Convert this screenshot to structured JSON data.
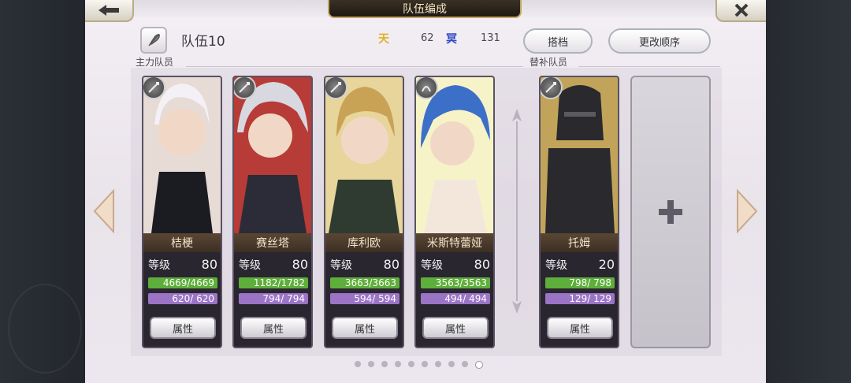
{
  "header": {
    "title": "队伍编成"
  },
  "team": {
    "name": "队伍10",
    "resource1_icon": "天",
    "resource1_value": "62",
    "resource2_icon": "冥",
    "resource2_value": "131"
  },
  "buttons": {
    "partner": "搭档",
    "change_order": "更改顺序",
    "attribute": "属性"
  },
  "sections": {
    "main": "主力队员",
    "sub": "替补队员"
  },
  "level_label": "等级",
  "members": [
    {
      "name": "桔梗",
      "level": "80",
      "hp": "4669/4669",
      "mp": "620/ 620",
      "palette": [
        "#f4f1f6",
        "#1b1b22",
        "#e7dbd6"
      ]
    },
    {
      "name": "赛丝塔",
      "level": "80",
      "hp": "1182/1782",
      "mp": "794/ 794",
      "palette": [
        "#d8d8e0",
        "#2c2c38",
        "#b73b36"
      ]
    },
    {
      "name": "库利欧",
      "level": "80",
      "hp": "3663/3663",
      "mp": "594/ 594",
      "palette": [
        "#caa256",
        "#2f3b30",
        "#e7d59c"
      ]
    },
    {
      "name": "米斯特蕾娅",
      "level": "80",
      "hp": "3563/3563",
      "mp": "494/ 494",
      "palette": [
        "#3c6fc7",
        "#f3e7dc",
        "#f7f3c8"
      ]
    }
  ],
  "sub_members": [
    {
      "name": "托姆",
      "level": "20",
      "hp": "798/ 798",
      "mp": "129/ 129",
      "palette": [
        "#5a5a5f",
        "#2a2a2e",
        "#c1a45a"
      ]
    }
  ],
  "empty_slot_icon": "plus-icon",
  "pagination": {
    "count": 10,
    "active": 9
  }
}
